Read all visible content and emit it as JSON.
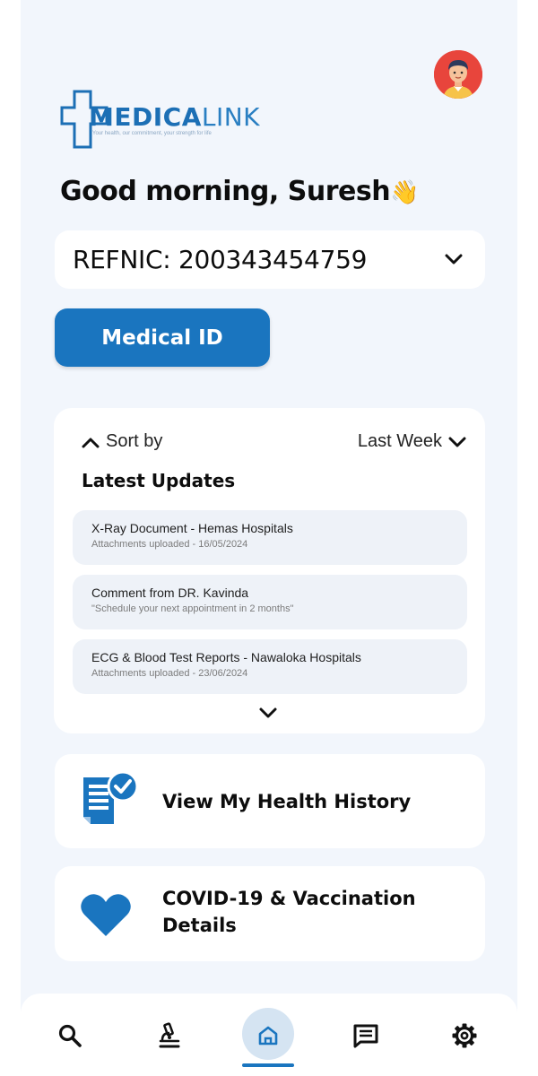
{
  "brand": {
    "name_bold": "MEDICA",
    "name_light": "LINK",
    "tagline": "Your health, our commitment, your strength for life"
  },
  "greeting": {
    "text": "Good morning, Suresh",
    "emoji": "👋"
  },
  "account": {
    "refnic": "REFNIC: 200343454759"
  },
  "medical_id_button": "Medical ID",
  "updates": {
    "sort_label": "Sort by",
    "range_label": "Last Week",
    "heading": "Latest Updates",
    "items": [
      {
        "title": "X-Ray Document - Hemas Hospitals",
        "subtitle": "Attachments uploaded - 16/05/2024"
      },
      {
        "title": "Comment from DR. Kavinda",
        "subtitle": "\"Schedule your next appointment in 2 months\""
      },
      {
        "title": "ECG & Blood Test Reports - Nawaloka Hospitals",
        "subtitle": "Attachments uploaded - 23/06/2024"
      }
    ]
  },
  "cards": {
    "history": "View My Health History",
    "covid_line1": "COVID-19 & Vaccination",
    "covid_line2": "Details"
  },
  "nav": {
    "items": [
      "search-icon",
      "microscope-icon",
      "home-icon",
      "messages-icon",
      "settings-icon"
    ],
    "active": "home-icon"
  },
  "colors": {
    "primary": "#1a75bf",
    "background": "#f2f6fc",
    "avatar": "#e8453c"
  }
}
